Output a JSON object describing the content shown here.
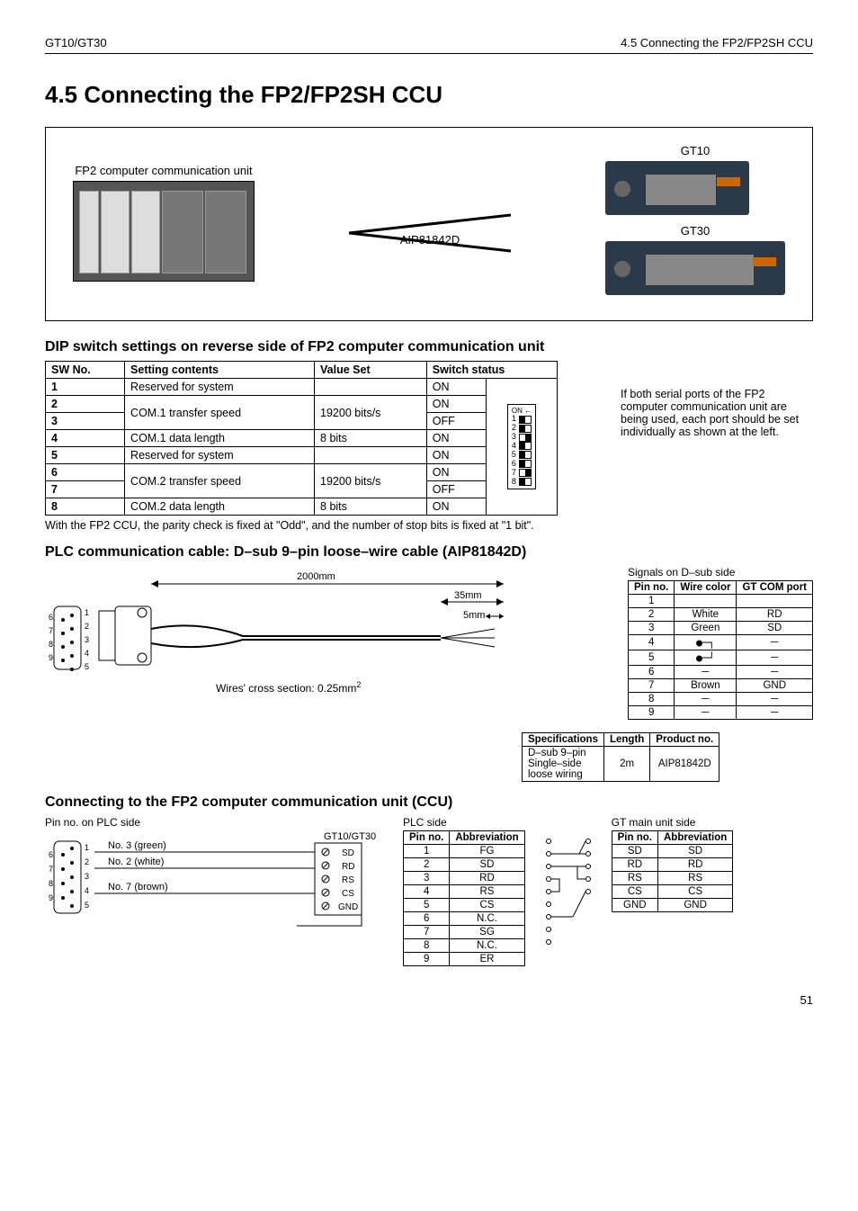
{
  "header": {
    "left": "GT10/GT30",
    "right": "4.5   Connecting the FP2/FP2SH CCU"
  },
  "title": "4.5    Connecting the FP2/FP2SH CCU",
  "diagram": {
    "fp2_label": "FP2 computer communication unit",
    "cable_part": "AIP81842D",
    "gt10_label": "GT10",
    "gt30_label": "GT30"
  },
  "dip_heading": "DIP switch settings on reverse side of FP2 computer communication unit",
  "dip_note": "If both serial ports of the FP2 computer communication unit are being used, each port should be set individually as shown at the left.",
  "dip_headers": [
    "SW No.",
    "Setting contents",
    "Value Set",
    "Switch status"
  ],
  "dip_rows": [
    {
      "no": "1",
      "contents": "Reserved for system",
      "value": "",
      "status": "ON"
    },
    {
      "no": "2",
      "contents": "COM.1 transfer speed",
      "value": "19200 bits/s",
      "status": "ON"
    },
    {
      "no": "3",
      "contents": "",
      "value": "",
      "status": "OFF"
    },
    {
      "no": "4",
      "contents": "COM.1 data length",
      "value": "8 bits",
      "status": "ON"
    },
    {
      "no": "5",
      "contents": "Reserved for system",
      "value": "",
      "status": "ON"
    },
    {
      "no": "6",
      "contents": "COM.2 transfer speed",
      "value": "19200 bits/s",
      "status": "ON"
    },
    {
      "no": "7",
      "contents": "",
      "value": "",
      "status": "OFF"
    },
    {
      "no": "8",
      "contents": "COM.2 data length",
      "value": "8 bits",
      "status": "ON"
    }
  ],
  "dip_footnote": "With the FP2 CCU, the parity check is fixed at \"Odd\", and the number of stop bits is fixed at \"1 bit\".",
  "cable_heading": "PLC communication cable: D–sub 9–pin loose–wire cable (AIP81842D)",
  "cable": {
    "length_total": "2000mm",
    "length_strip": "35mm",
    "length_wire": "5mm",
    "cross_section": "Wires' cross section: 0.25mm",
    "cross_section_sup": "2",
    "conn_left_nums_outer": [
      "6",
      "7",
      "8",
      "9"
    ],
    "conn_left_nums_inner": [
      "1",
      "2",
      "3",
      "4",
      "5"
    ]
  },
  "signals_title": "Signals on D–sub side",
  "signals_headers": [
    "Pin no.",
    "Wire color",
    "GT COM port"
  ],
  "signals_rows": [
    {
      "pin": "1",
      "color": "",
      "port": ""
    },
    {
      "pin": "2",
      "color": "White",
      "port": "RD"
    },
    {
      "pin": "3",
      "color": "Green",
      "port": "SD"
    },
    {
      "pin": "4",
      "color": "●─┐",
      "port": "─"
    },
    {
      "pin": "5",
      "color": "●─┘",
      "port": "─"
    },
    {
      "pin": "6",
      "color": "─",
      "port": "─"
    },
    {
      "pin": "7",
      "color": "Brown",
      "port": "GND"
    },
    {
      "pin": "8",
      "color": "─",
      "port": "─"
    },
    {
      "pin": "9",
      "color": "─",
      "port": "─"
    }
  ],
  "specs_headers": [
    "Specifications",
    "Length",
    "Product no."
  ],
  "specs_row": {
    "spec": "D–sub 9–pin\nSingle–side\nloose wiring",
    "length": "2m",
    "product": "AIP81842D"
  },
  "connect_heading": "Connecting to the FP2 computer communication unit (CCU)",
  "connect": {
    "plc_pin_label": "Pin no. on PLC side",
    "wires": [
      {
        "num": "",
        "text": "No. 3 (green)"
      },
      {
        "num": "",
        "text": "No. 2 (white)"
      },
      {
        "num": "",
        "text": "No. 7 (brown)"
      }
    ],
    "gt_conn_label": "GT10/GT30",
    "gt_conn_pins": [
      "SD",
      "RD",
      "RS",
      "CS",
      "GND"
    ],
    "conn_left_outer": [
      "6",
      "7",
      "8",
      "9"
    ],
    "conn_left_inner": [
      "1",
      "2",
      "3",
      "4",
      "5"
    ]
  },
  "plc_side_title": "PLC side",
  "plc_side_headers": [
    "Pin no.",
    "Abbreviation"
  ],
  "plc_side_rows": [
    {
      "pin": "1",
      "abbr": "FG"
    },
    {
      "pin": "2",
      "abbr": "SD"
    },
    {
      "pin": "3",
      "abbr": "RD"
    },
    {
      "pin": "4",
      "abbr": "RS"
    },
    {
      "pin": "5",
      "abbr": "CS"
    },
    {
      "pin": "6",
      "abbr": "N.C."
    },
    {
      "pin": "7",
      "abbr": "SG"
    },
    {
      "pin": "8",
      "abbr": "N.C."
    },
    {
      "pin": "9",
      "abbr": "ER"
    }
  ],
  "gt_side_title": "GT main unit side",
  "gt_side_headers": [
    "Pin no.",
    "Abbreviation"
  ],
  "gt_side_rows": [
    {
      "pin": "SD",
      "abbr": "SD"
    },
    {
      "pin": "RD",
      "abbr": "RD"
    },
    {
      "pin": "RS",
      "abbr": "RS"
    },
    {
      "pin": "CS",
      "abbr": "CS"
    },
    {
      "pin": "GND",
      "abbr": "GND"
    }
  ],
  "page_number": "51",
  "chart_data": {
    "type": "table",
    "tables": [
      {
        "name": "DIP switch settings",
        "columns": [
          "SW No.",
          "Setting contents",
          "Value Set",
          "Switch status"
        ],
        "rows": [
          [
            "1",
            "Reserved for system",
            "",
            "ON"
          ],
          [
            "2",
            "COM.1 transfer speed",
            "19200 bits/s",
            "ON"
          ],
          [
            "3",
            "COM.1 transfer speed",
            "19200 bits/s",
            "OFF"
          ],
          [
            "4",
            "COM.1 data length",
            "8 bits",
            "ON"
          ],
          [
            "5",
            "Reserved for system",
            "",
            "ON"
          ],
          [
            "6",
            "COM.2 transfer speed",
            "19200 bits/s",
            "ON"
          ],
          [
            "7",
            "COM.2 transfer speed",
            "19200 bits/s",
            "OFF"
          ],
          [
            "8",
            "COM.2 data length",
            "8 bits",
            "ON"
          ]
        ]
      },
      {
        "name": "Signals on D-sub side",
        "columns": [
          "Pin no.",
          "Wire color",
          "GT COM port"
        ],
        "rows": [
          [
            "1",
            "",
            ""
          ],
          [
            "2",
            "White",
            "RD"
          ],
          [
            "3",
            "Green",
            "SD"
          ],
          [
            "4",
            "(short to 5)",
            "-"
          ],
          [
            "5",
            "(short to 4)",
            "-"
          ],
          [
            "6",
            "-",
            "-"
          ],
          [
            "7",
            "Brown",
            "GND"
          ],
          [
            "8",
            "-",
            "-"
          ],
          [
            "9",
            "-",
            "-"
          ]
        ]
      },
      {
        "name": "Cable specifications",
        "columns": [
          "Specifications",
          "Length",
          "Product no."
        ],
        "rows": [
          [
            "D-sub 9-pin Single-side loose wiring",
            "2m",
            "AIP81842D"
          ]
        ]
      },
      {
        "name": "PLC side pinout",
        "columns": [
          "Pin no.",
          "Abbreviation"
        ],
        "rows": [
          [
            "1",
            "FG"
          ],
          [
            "2",
            "SD"
          ],
          [
            "3",
            "RD"
          ],
          [
            "4",
            "RS"
          ],
          [
            "5",
            "CS"
          ],
          [
            "6",
            "N.C."
          ],
          [
            "7",
            "SG"
          ],
          [
            "8",
            "N.C."
          ],
          [
            "9",
            "ER"
          ]
        ]
      },
      {
        "name": "GT main unit side pinout",
        "columns": [
          "Pin no.",
          "Abbreviation"
        ],
        "rows": [
          [
            "SD",
            "SD"
          ],
          [
            "RD",
            "RD"
          ],
          [
            "RS",
            "RS"
          ],
          [
            "CS",
            "CS"
          ],
          [
            "GND",
            "GND"
          ]
        ]
      }
    ]
  }
}
